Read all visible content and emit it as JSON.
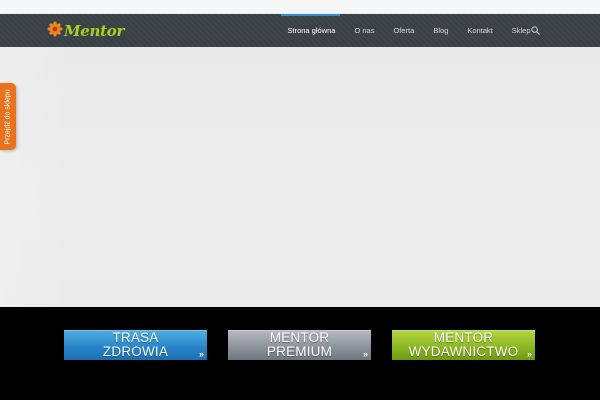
{
  "brand": {
    "logo_text": "Mentor",
    "logo_color": "#a7d31f",
    "flower_color": "#f08a1c"
  },
  "nav": {
    "items": [
      {
        "label": "Strona główna",
        "active": true
      },
      {
        "label": "O nas",
        "active": false
      },
      {
        "label": "Oferta",
        "active": false
      },
      {
        "label": "Blog",
        "active": false
      },
      {
        "label": "Kontakt",
        "active": false
      },
      {
        "label": "Sklep",
        "active": false
      }
    ],
    "search_icon": "search-icon",
    "active_color": "#2a8ed1",
    "background_color": "#394147"
  },
  "side_tab": {
    "label": "Przejdź do sklepu",
    "color": "#e8731f"
  },
  "banners": [
    {
      "line1": "TRASA",
      "line2": "ZDROWIA",
      "arrow": "»",
      "color": "#2a86c9"
    },
    {
      "line1": "MENTOR",
      "line2": "PREMIUM",
      "arrow": "»",
      "color": "#8e949c"
    },
    {
      "line1": "MENTOR",
      "line2": "WYDAWNICTWO",
      "arrow": "»",
      "color": "#8cb723"
    }
  ]
}
